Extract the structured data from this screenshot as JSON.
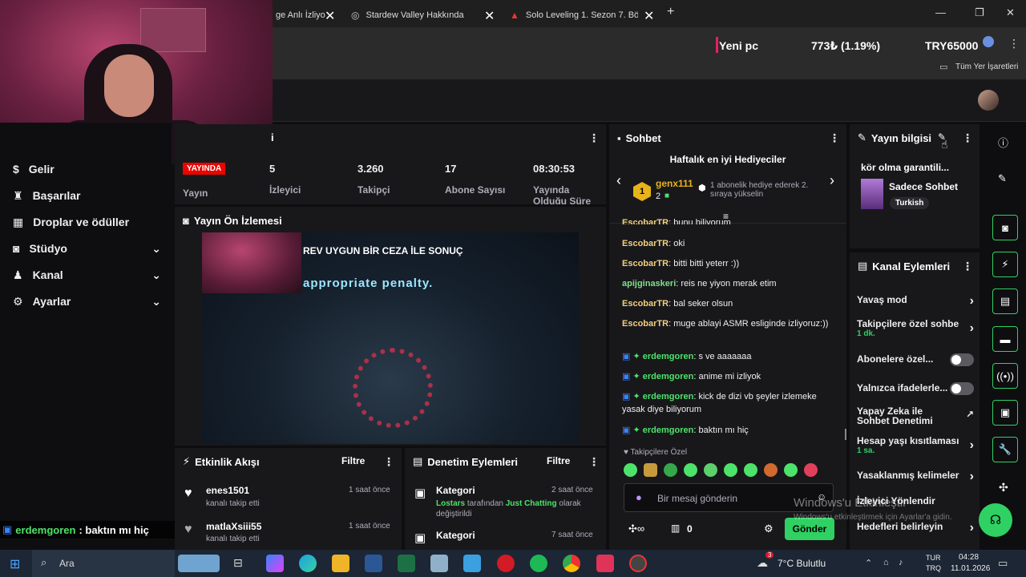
{
  "browser": {
    "tabs": [
      {
        "title": "ge Anlı İzliyo"
      },
      {
        "title": "Stardew Valley Hakkında"
      },
      {
        "title": "Solo Leveling 1. Sezon 7. Bölüm"
      }
    ],
    "new_tab": "+",
    "ticker": {
      "label": "Yeni pc",
      "amount": "773₺ (1.19%)",
      "goal": "TRY65000"
    },
    "bookmarks_label": "Tüm Yer İşaretleri"
  },
  "sidebar": {
    "items": [
      {
        "label": "Gelir"
      },
      {
        "label": "Başarılar"
      },
      {
        "label": "Droplar ve ödüller"
      },
      {
        "label": "Stüdyo"
      },
      {
        "label": "Kanal"
      },
      {
        "label": "Ayarlar"
      }
    ]
  },
  "stats": {
    "header_fragment": "i",
    "live_badge": "YAYINDA",
    "live_label": "Yayın",
    "viewers": {
      "value": "5",
      "label": "İzleyici"
    },
    "followers": {
      "value": "3.260",
      "label": "Takipçi"
    },
    "subs": {
      "value": "17",
      "label": "Abone Sayısı"
    },
    "uptime": {
      "value": "08:30:53",
      "label": "Yayında Olduğu Süre"
    }
  },
  "preview": {
    "title": "Yayın Ön İzlemesi",
    "caption_top": "REV UYGUN BİR CEZA İLE SONUÇ",
    "caption_main": "appropriate penalty."
  },
  "activity": {
    "title": "Etkinlik Akışı",
    "filter": "Filtre",
    "items": [
      {
        "user": "enes1501",
        "action": "kanalı takip etti",
        "time": "1 saat önce"
      },
      {
        "user": "matlaXsiii55",
        "action": "kanalı takip etti",
        "time": "1 saat önce"
      }
    ]
  },
  "moderation": {
    "title": "Denetim Eylemleri",
    "filter": "Filtre",
    "items": [
      {
        "type": "Kategori",
        "time": "2 saat önce",
        "actor": "Lostars",
        "mid": "tarafından",
        "category": "Just Chatting",
        "rest": "olarak",
        "line2": "değiştirildi"
      },
      {
        "type": "Kategori",
        "time": "7 saat önce"
      }
    ]
  },
  "chat": {
    "title": "Sohbet",
    "top_gifters_title": "Haftalık en iyi Hediyeciler",
    "gifter_name": "genx111",
    "gifter_count": "2",
    "gifter_rank": "1",
    "gifter_note": "1 abonelik hediye ederek 2. sıraya yükselin",
    "messages": [
      {
        "user": "EscobarTR",
        "text": "bunu biliyorum",
        "color": "#f0d080"
      },
      {
        "user": "EscobarTR",
        "text": "oki",
        "color": "#f0d080"
      },
      {
        "user": "EscobarTR",
        "text": "bitti bitti yeterr :))",
        "color": "#f0d080"
      },
      {
        "user": "apijginaskeri",
        "text": "reis ne yiyon merak etim",
        "color": "#7fe08a"
      },
      {
        "user": "EscobarTR",
        "text": "bal seker olsun",
        "color": "#f0d080"
      },
      {
        "user": "EscobarTR",
        "text": "muge ablayi ASMR esliginde izliyoruz:))",
        "color": "#f0d080"
      },
      {
        "user": "erdemgoren",
        "text": "s ve aaaaaaa",
        "color": "#4de36a"
      },
      {
        "user": "erdemgoren",
        "text": "anime mi izliyok",
        "color": "#4de36a"
      },
      {
        "user": "erdemgoren",
        "text": "kick de dizi vb şeyler izlemeke yasak diye biliyorum",
        "color": "#4de36a"
      },
      {
        "user": "erdemgoren",
        "text": "baktın mı hiç",
        "color": "#4de36a"
      }
    ],
    "followers_only": "Takipçilere Özel",
    "input_placeholder": "Bir mesaj gönderin",
    "points": "0",
    "send": "Gönder"
  },
  "overlay_chat": {
    "user": "erdemgoren",
    "text": ": baktın mı hiç"
  },
  "stream_info": {
    "title": "Yayın bilgisi",
    "stream_title": "kör olma garantili...",
    "category": "Sadece Sohbet",
    "tag": "Turkish"
  },
  "channel_actions": {
    "title": "Kanal Eylemleri",
    "items": [
      {
        "label": "Yavaş mod"
      },
      {
        "label": "Takipçilere özel sohbe",
        "sub": "1 dk."
      },
      {
        "label": "Abonelere özel..."
      },
      {
        "label": "Yalnızca ifadelerle..."
      },
      {
        "label": "Yapay Zeka ile Sohbet Denetimi"
      },
      {
        "label": "Hesap yaşı kısıtlaması",
        "sub": "1 sa."
      },
      {
        "label": "Yasaklanmış kelimeler"
      },
      {
        "label": "İzleyici Yönlendir"
      },
      {
        "label": "Hedefleri belirleyin"
      }
    ]
  },
  "watermark": {
    "line1": "Windows'u Etkinleştir",
    "line2": "Windows'u etkinleştirmek için Ayarlar'a gidin."
  },
  "taskbar": {
    "search": "Ara",
    "weather": "7°C Bulutlu",
    "weather_badge": "3",
    "lang1": "TUR",
    "lang2": "TRQ",
    "time": "04:28",
    "date": "11.01.2026"
  },
  "colors": {
    "accent_green": "#2fd163",
    "live_red": "#eb0400",
    "chat_input_mic": "#bf94ff"
  }
}
